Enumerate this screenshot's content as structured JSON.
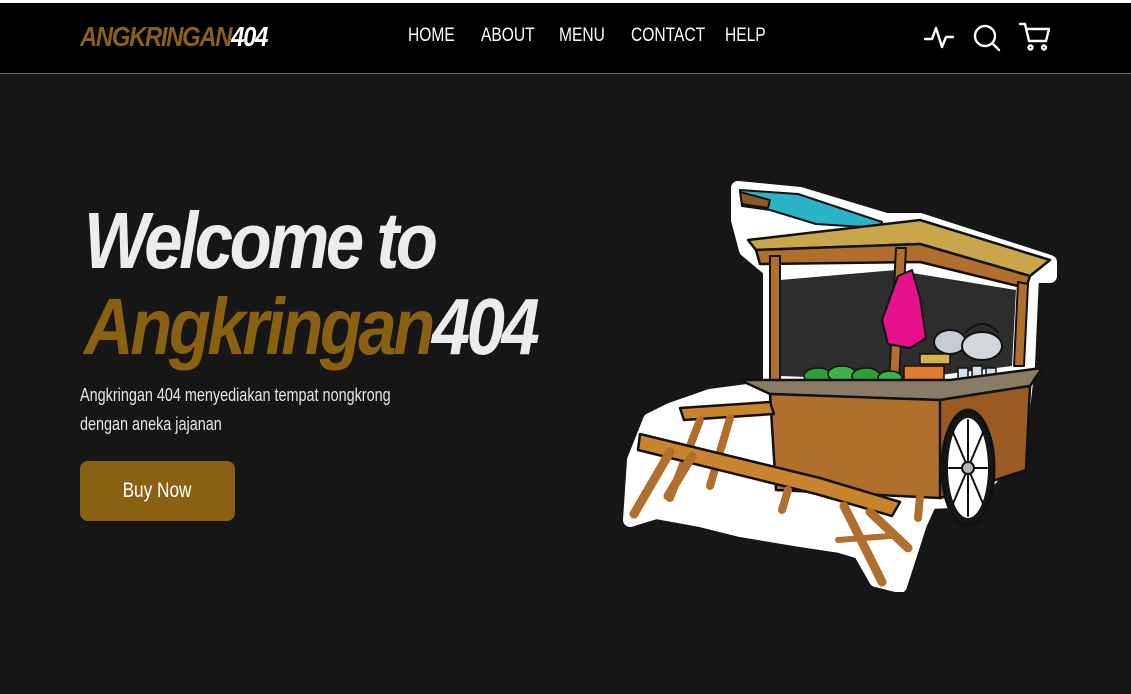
{
  "navbar": {
    "logo": {
      "brand": "ANGKRINGAN",
      "number": "404"
    },
    "links": [
      "HOME",
      "ABOUT",
      "MENU",
      "CONTACT",
      "HELP"
    ],
    "icons": [
      "activity-icon",
      "search-icon",
      "shopping-cart-icon"
    ]
  },
  "hero": {
    "title_line1": "Welcome to",
    "title_brand": "Angkringan",
    "title_number": "404",
    "description_line1": "Angkringan 404 menyediakan tempat nongkrong",
    "description_line2": "dengan aneka jajanan",
    "button_label": "Buy Now",
    "image": "angkringan-cart-illustration"
  },
  "colors": {
    "background": "#161616",
    "navbar": "#000000",
    "accent": "#8a6113",
    "text": "#ffffff"
  }
}
